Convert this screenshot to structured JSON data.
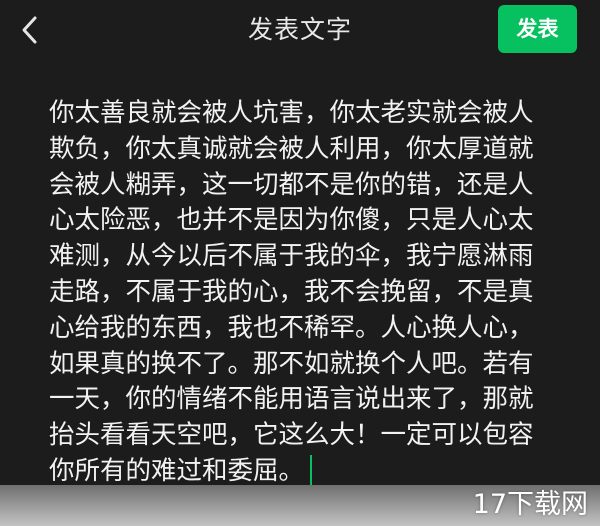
{
  "header": {
    "title": "发表文字",
    "back_icon": "chevron-left-icon",
    "publish_label": "发表"
  },
  "editor": {
    "text": " 你太善良就会被人坑害，你太老实就会被人欺负，你太真诚就会被人利用，你太厚道就会被人糊弄，这一切都不是你的错，还是人心太险恶，也并不是因为你傻，只是人心太难测，从今以后不属于我的伞，我宁愿淋雨走路，不属于我的心，我不会挽留，不是真心给我的东西，我也不稀罕。人心换人心，如果真的换不了。那不如就换个人吧。若有一天，你的情绪不能用语言说出来了，那就抬头看看天空吧，它这么大！一定可以包容你所有的难过和委屈。"
  },
  "watermark": "17下载网",
  "colors": {
    "background": "#1c1c1c",
    "accent": "#07c160",
    "text": "#f2f2f2"
  }
}
